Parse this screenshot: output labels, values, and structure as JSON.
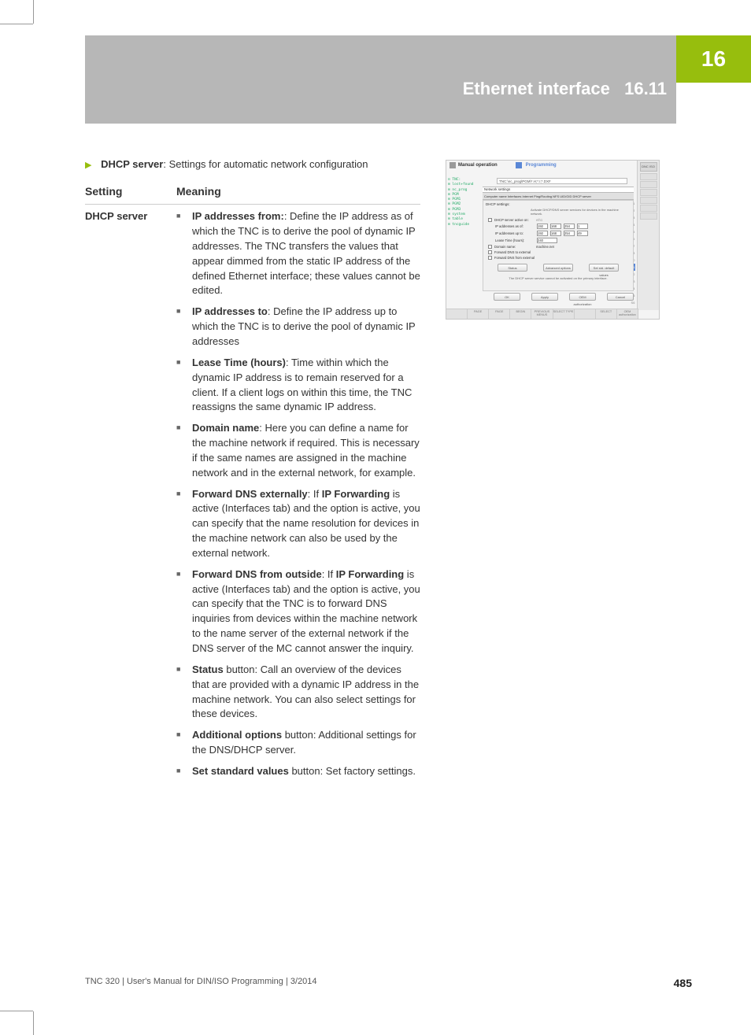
{
  "chapter_number": "16",
  "header": {
    "title": "Ethernet interface",
    "section": "16.11"
  },
  "intro": {
    "bold": "DHCP server",
    "rest": ": Settings for automatic network configuration"
  },
  "table": {
    "head_setting": "Setting",
    "head_meaning": "Meaning",
    "row_setting": "DHCP server",
    "items": [
      {
        "b": "IP addresses from:",
        "t": ": Define the IP address as of which the TNC is to derive the pool of dynamic IP addresses. The TNC transfers the values that appear dimmed from the static IP address of the defined Ethernet interface; these values cannot be edited."
      },
      {
        "b": "IP addresses to",
        "t": ": Define the IP address up to which the TNC is to derive the pool of dynamic IP addresses"
      },
      {
        "b": "Lease Time (hours)",
        "t": ": Time within which the dynamic IP address is to remain reserved for a client. If a client logs on within this time, the TNC reassigns the same dynamic IP address."
      },
      {
        "b": "Domain name",
        "t": ": Here you can define a name for the machine network if required. This is necessary if the same names are assigned in the machine network and in the external network, for example."
      },
      {
        "b1": "Forward DNS externally",
        "mid": ": If ",
        "b2": "IP Forwarding",
        "t": " is active (Interfaces tab) and the option is active, you can specify that the name resolution for devices in the machine network can also be used by the external network."
      },
      {
        "b1": "Forward DNS from outside",
        "mid": ": If ",
        "b2": "IP Forwarding",
        "t": " is active (Interfaces tab) and the option is active, you can specify that the TNC is to forward DNS inquiries from devices within the machine network to the name server of the external network if the DNS server of the MC cannot answer the inquiry."
      },
      {
        "b": "Status",
        "t": " button: Call an overview of the devices that are provided with a dynamic IP address in the machine network. You can also select settings for these devices."
      },
      {
        "b": "Additional options",
        "t": " button: Additional settings for the DNS/DHCP server."
      },
      {
        "b": "Set standard values",
        "t": " button: Set factory settings."
      }
    ]
  },
  "screenshot": {
    "mode1": "Manual operation",
    "mode2": "Programming",
    "right_top_btn": "DNC ISO",
    "path": "TNC:\\nc_prog\\PGM\\*.H;*.I;*.DXF",
    "dialog_title": "Network settings",
    "tabs": "Computer name  Interfaces  Internet  Ping/Routing  NFS UID/GID  DHCP server",
    "panel_title": "DHCP settings:",
    "panel_note": "Activate DHCP/DNS server services for devices in the machine network.",
    "rows": {
      "active": "DHCP server active on:",
      "from": "IP addresses as of:",
      "to": "IP addresses up to:",
      "lease": "Lease Time (hours):",
      "domain": "Domain name:",
      "fwd_ext": "Forward DNS to external",
      "fwd_out": "Forward DNS from external"
    },
    "vals": {
      "if": "eth1",
      "o1": "192",
      "o2": "168",
      "o3": "254",
      "o4a": "1",
      "o4b": "49",
      "lease": "240",
      "domain": "machine.net"
    },
    "btns": {
      "status": "Status",
      "advanced": "Advanced options",
      "std": "Set std. default values",
      "ok": "OK",
      "apply": "Apply",
      "oem": "OEM authorization",
      "cancel": "Cancel"
    },
    "hint": "The DHCP server service cannot be activated on the primary interface.",
    "tree": [
      "TNC:",
      "lost+found",
      "nc_prog",
      "PGM",
      "PGM1",
      "PGM2",
      "PGM3",
      "system",
      "table",
      "tncguide"
    ],
    "softkeys": [
      "",
      "PAGE",
      "PAGE",
      "BEGIN",
      "PREVIOUS MENUS",
      "SELECT TYPE",
      "",
      "SELECT",
      "OEM authorization"
    ],
    "scroll_marks": [
      "F1",
      "F2",
      "F3",
      "F4",
      "F5",
      "F6",
      "F7",
      "F8",
      "S0",
      "S1",
      "S2",
      "S3",
      "S4",
      "S5",
      "S6",
      "S7"
    ],
    "scroll_active_index": 9
  },
  "footer": {
    "left": "TNC 320 | User's Manual for DIN/ISO Programming | 3/2014",
    "page": "485"
  }
}
